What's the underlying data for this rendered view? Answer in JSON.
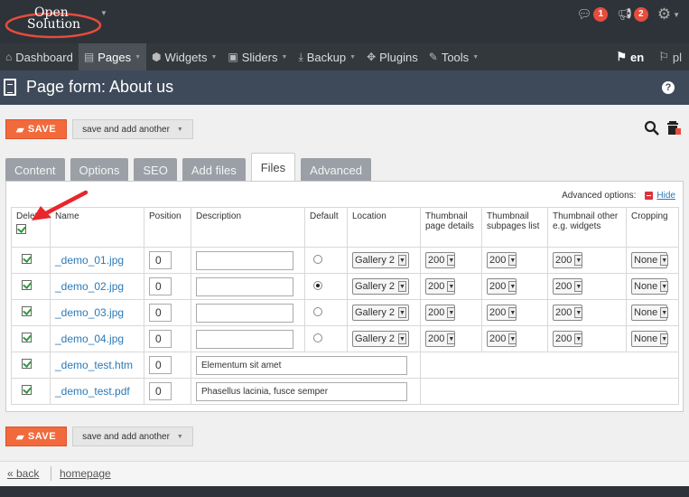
{
  "brand": {
    "line1": "Open",
    "line2": "Solution",
    "accent": "#e74c3c"
  },
  "notifications": {
    "comments_count": "1",
    "messages_count": "2"
  },
  "nav": {
    "items": [
      {
        "label": "Dashboard",
        "icon": "home-icon"
      },
      {
        "label": "Pages",
        "icon": "document-icon",
        "active": true
      },
      {
        "label": "Widgets",
        "icon": "cube-icon"
      },
      {
        "label": "Sliders",
        "icon": "slider-image-icon"
      },
      {
        "label": "Backup",
        "icon": "download-icon"
      },
      {
        "label": "Plugins",
        "icon": "puzzle-icon"
      },
      {
        "label": "Tools",
        "icon": "wrench-icon"
      }
    ],
    "languages": [
      "en",
      "pl"
    ],
    "active_language": "en"
  },
  "page": {
    "title": "Page form: About us"
  },
  "toolbar": {
    "save_label": "SAVE",
    "save_add_label": "save and add another",
    "save_color": "#f26a3c"
  },
  "tabs": [
    "Content",
    "Options",
    "SEO",
    "Add files",
    "Files",
    "Advanced"
  ],
  "active_tab": "Files",
  "advanced_options": {
    "label": "Advanced options:",
    "hide_label": "Hide"
  },
  "table": {
    "headers": {
      "delete": "Delete",
      "name": "Name",
      "position": "Position",
      "description": "Description",
      "default": "Default",
      "location": "Location",
      "thumb_page": "Thumbnail page details",
      "thumb_sub": "Thumbnail subpages list",
      "thumb_other": "Thumbnail other e.g. widgets",
      "cropping": "Cropping"
    },
    "rows": [
      {
        "name": "_demo_01.jpg",
        "position": "0",
        "description": "",
        "default": false,
        "location": "Gallery 2",
        "t1": "200",
        "t2": "200",
        "t3": "200",
        "crop": "None"
      },
      {
        "name": "_demo_02.jpg",
        "position": "0",
        "description": "",
        "default": true,
        "location": "Gallery 2",
        "t1": "200",
        "t2": "200",
        "t3": "200",
        "crop": "None"
      },
      {
        "name": "_demo_03.jpg",
        "position": "0",
        "description": "",
        "default": false,
        "location": "Gallery 2",
        "t1": "200",
        "t2": "200",
        "t3": "200",
        "crop": "None"
      },
      {
        "name": "_demo_04.jpg",
        "position": "0",
        "description": "",
        "default": false,
        "location": "Gallery 2",
        "t1": "200",
        "t2": "200",
        "t3": "200",
        "crop": "None"
      },
      {
        "name": "_demo_test.htm",
        "position": "0",
        "description": "Elementum sit amet"
      },
      {
        "name": "_demo_test.pdf",
        "position": "0",
        "description": "Phasellus lacinia, fusce semper"
      }
    ]
  },
  "footer": {
    "back_label": "« back",
    "home_label": "homepage"
  }
}
